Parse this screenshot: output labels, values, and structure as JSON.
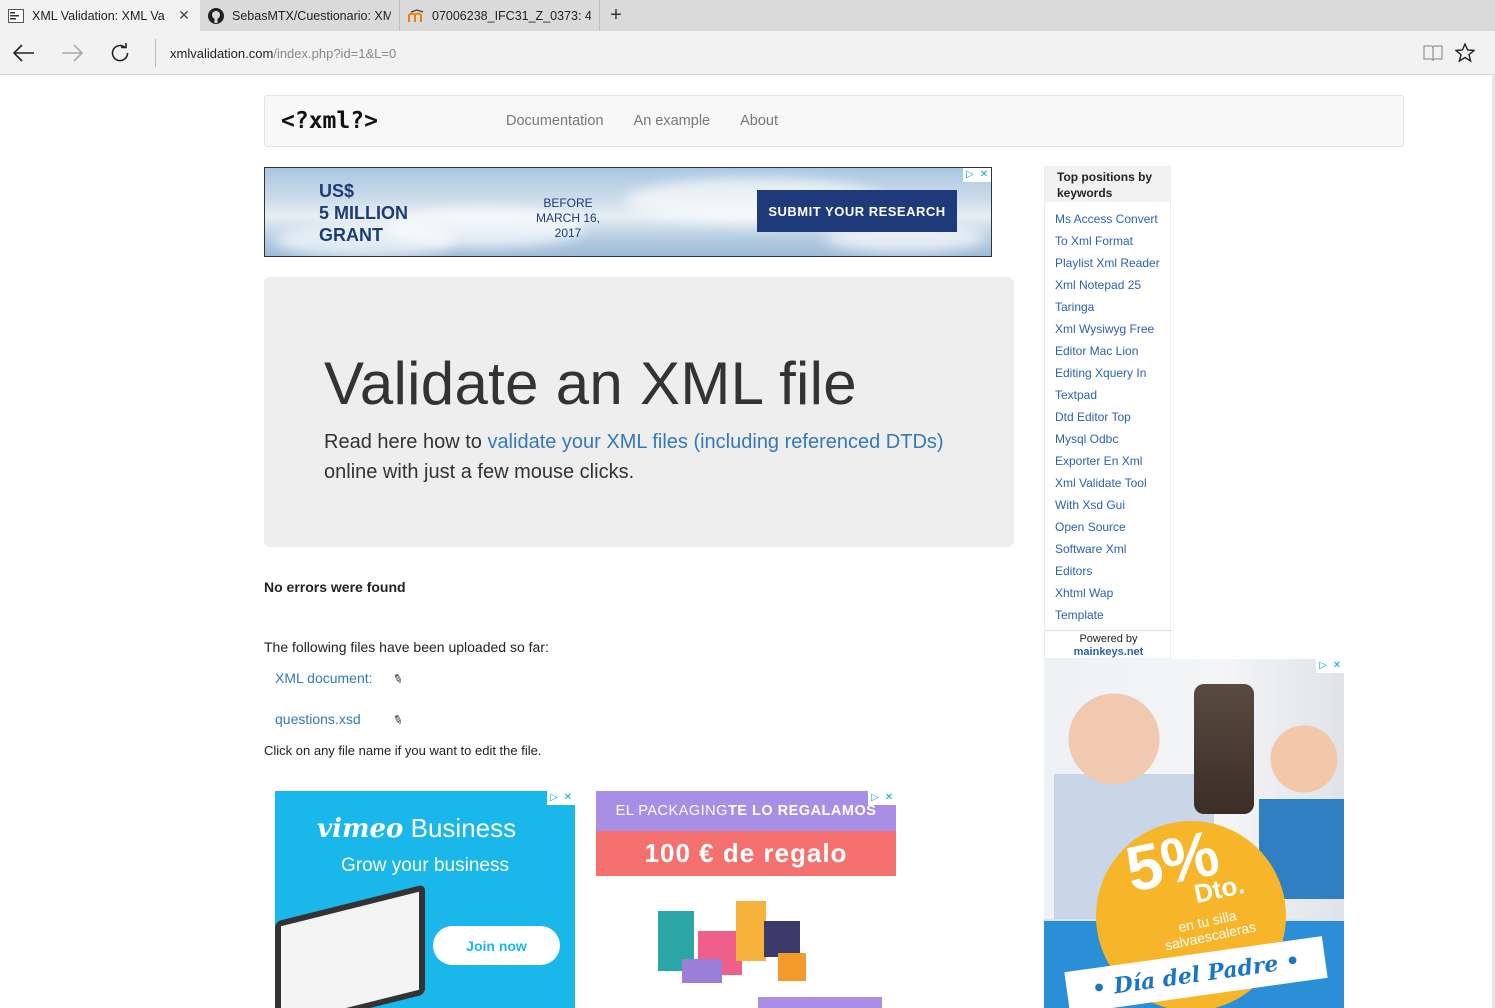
{
  "browser": {
    "tabs": [
      {
        "title": "XML Validation: XML Va",
        "favicon": "xml-favicon",
        "active": true
      },
      {
        "title": "SebasMTX/Cuestionario: XM",
        "favicon": "github-icon",
        "active": false
      },
      {
        "title": "07006238_IFC31_Z_0373: 4.",
        "favicon": "moodle-icon",
        "active": false
      }
    ],
    "new_tab": "+",
    "url_domain": "xmlvalidation.com",
    "url_path": "/index.php?id=1&L=0"
  },
  "site": {
    "logo": "<?xml?>",
    "nav": [
      "Documentation",
      "An example",
      "About"
    ]
  },
  "banner_ad": {
    "headline": [
      "US$",
      "5 MILLION",
      "GRANT"
    ],
    "before": "BEFORE",
    "date": "MARCH 16, 2017",
    "cta": "SUBMIT YOUR  RESEARCH"
  },
  "jumbotron": {
    "title": "Validate an XML file",
    "lead_before": "Read here how to ",
    "lead_link": "validate your XML files (including referenced DTDs)",
    "lead_after": " online with just a few mouse clicks."
  },
  "result": {
    "status": "No errors were found",
    "uploaded_intro": "The following files have been uploaded so far:",
    "files": [
      "XML document:",
      "questions.xsd"
    ],
    "edit_hint": "Click on any file name if you want to edit the file."
  },
  "vimeo_ad": {
    "brand_main": "vimeo",
    "brand_sub": "Business",
    "tagline": "Grow your business",
    "cta": "Join now"
  },
  "packaging_ad": {
    "top_light": "EL PACKAGING ",
    "top_bold": "TE LO REGALAMOS",
    "offer": "100 € de regalo"
  },
  "keywords": {
    "heading": "Top positions by keywords",
    "items": [
      "Ms Access Convert",
      "To Xml Format",
      "Playlist Xml Reader",
      "Xml Notepad 25",
      "Taringa",
      "Xml Wysiwyg Free",
      "Editor Mac Lion",
      "Editing Xquery In",
      "Textpad",
      "Dtd Editor Top",
      "Mysql Odbc",
      "Exporter En Xml",
      "Xml Validate Tool",
      "With Xsd Gui",
      "Open Source",
      "Software Xml",
      "Editors",
      "Xhtml Wap",
      "Template"
    ],
    "powered_by": "Powered by",
    "powered_link": "mainkeys.net"
  },
  "senior_ad": {
    "percent": "5%",
    "dto": "Dto.",
    "subtitle": "en tu silla salvaescaleras",
    "ribbon": "• Día del Padre •"
  },
  "colors": {
    "link": "#337ab7",
    "vimeo_blue": "#1ab7ea",
    "pack_purple": "#a98ee6",
    "pack_coral": "#f4716f",
    "ad_orange": "#f7b52a"
  }
}
